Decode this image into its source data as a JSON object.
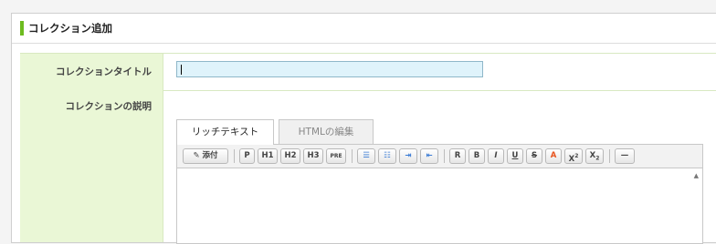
{
  "panel": {
    "title": "コレクション追加",
    "accent_color": "#6dbb1f"
  },
  "form": {
    "title_label": "コレクションタイトル",
    "title_value": "",
    "description_label": "コレクションの説明"
  },
  "editor": {
    "tabs": [
      {
        "label": "リッチテキスト",
        "active": true
      },
      {
        "label": "HTMLの編集",
        "active": false
      }
    ],
    "toolbar": {
      "attach": "添付",
      "p": "P",
      "h1": "H1",
      "h2": "H2",
      "h3": "H3",
      "pre": "PRE",
      "r": "R",
      "b": "B",
      "i": "I",
      "u": "U",
      "s": "S",
      "a": "A",
      "sup": "X",
      "sub": "X",
      "hr": "—"
    },
    "icons": [
      "paperclip-icon",
      "ordered-list-icon",
      "unordered-list-icon",
      "indent-icon",
      "outdent-icon",
      "scroll-up-arrow-icon"
    ],
    "content": ""
  }
}
